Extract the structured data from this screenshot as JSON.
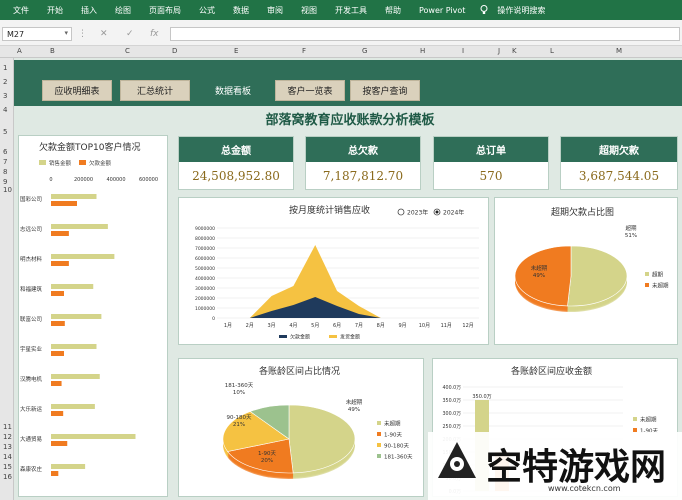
{
  "ribbon": {
    "menu": [
      "文件",
      "开始",
      "插入",
      "绘图",
      "页面布局",
      "公式",
      "数据",
      "审阅",
      "视图",
      "开发工具",
      "帮助",
      "Power Pivot"
    ],
    "search": "操作说明搜索"
  },
  "formula": {
    "name_box": "M27",
    "fx": "fx"
  },
  "columns": [
    "A",
    "B",
    "C",
    "D",
    "E",
    "F",
    "G",
    "H",
    "I",
    "J",
    "K",
    "L",
    "M"
  ],
  "rows": [
    "1",
    "2",
    "3",
    "4",
    "5",
    "6",
    "7",
    "8",
    "9",
    "10",
    "11",
    "12",
    "13",
    "14",
    "15",
    "16"
  ],
  "tabs": [
    "应收明细表",
    "汇总统计",
    "数据看板",
    "客户一览表",
    "按客户查询"
  ],
  "dashboard_title": "部落窝教育应收账款分析模板",
  "kpis": [
    {
      "label": "总金额",
      "value": "24,508,952.80"
    },
    {
      "label": "总欠款",
      "value": "7,187,812.70"
    },
    {
      "label": "总订单",
      "value": "570"
    },
    {
      "label": "超期欠款",
      "value": "3,687,544.05"
    }
  ],
  "colors": {
    "green": "#2f6e58",
    "gold": "#f5c242",
    "navy": "#1f3a5c",
    "olive": "#d4d48a",
    "orange": "#f07b20",
    "tan": "#dad1bc"
  },
  "chart_data": [
    {
      "type": "bar",
      "title": "欠款金额TOP10客户情况",
      "series": [
        {
          "name": "销售金额",
          "values": [
            280000,
            350000,
            390000,
            260000,
            310000,
            280000,
            300000,
            270000,
            520000,
            210000
          ]
        },
        {
          "name": "欠款金额",
          "values": [
            160000,
            110000,
            110000,
            80000,
            85000,
            80000,
            65000,
            75000,
            100000,
            45000
          ]
        }
      ],
      "categories": [
        "国彩公司",
        "志远公司",
        "明杰材料",
        "和福建筑",
        "联富公司",
        "宇星实业",
        "汉腾电机",
        "大乐新运",
        "大通贸易",
        "森康农庄"
      ],
      "xticks": [
        "0",
        "200000",
        "400000",
        "600000",
        "800000"
      ]
    },
    {
      "type": "area",
      "title": "按月度统计销售应收",
      "legend": [
        "2023年",
        "2024年"
      ],
      "legend_selected": "2024年",
      "categories": [
        "1月",
        "2月",
        "3月",
        "4月",
        "5月",
        "6月",
        "7月",
        "8月",
        "9月",
        "10月",
        "11月",
        "12月"
      ],
      "yticks": [
        "0",
        "1000000",
        "2000000",
        "3000000",
        "4000000",
        "5000000",
        "6000000",
        "7000000",
        "8000000",
        "9000000"
      ],
      "ylim": [
        0,
        9000000
      ],
      "series": [
        {
          "name": "欠款金额",
          "values": [
            0,
            0,
            700000,
            1300000,
            2100000,
            1200000,
            400000,
            0,
            0,
            0,
            0,
            0
          ]
        },
        {
          "name": "发货金额",
          "values": [
            0,
            0,
            2200000,
            3200000,
            7300000,
            2700000,
            1200000,
            0,
            0,
            0,
            0,
            0
          ]
        }
      ]
    },
    {
      "type": "pie",
      "title": "超期欠款占比图",
      "labels": [
        "超期",
        "未超期"
      ],
      "values": [
        51,
        49
      ],
      "value_labels": [
        "超期\n51%",
        "未超期\n49%"
      ]
    },
    {
      "type": "pie",
      "title": "各账龄区间占比情况",
      "labels": [
        "未超期",
        "1-90天",
        "90-180天",
        "181-360天"
      ],
      "values": [
        49,
        20,
        21,
        10
      ],
      "value_labels": [
        "未超期\n49%",
        "1-90天\n20%",
        "90-180天\n21%",
        "181-360天\n10%"
      ]
    },
    {
      "type": "bar",
      "title": "各账龄区间应收金额",
      "categories": [
        "未超期",
        "1-90天"
      ],
      "values": [
        3500000,
        1500000
      ],
      "data_labels": [
        "350.0万"
      ],
      "yticks": [
        "0.0万",
        "50.0万",
        "100.0万",
        "150.0万",
        "200.0万",
        "250.0万",
        "300.0万",
        "350.0万",
        "400.0万"
      ],
      "ylim": [
        0,
        4000000
      ],
      "legend": [
        "未超期",
        "1-90天"
      ]
    }
  ],
  "watermark": {
    "text": "空特游戏网",
    "url": "www.cotekcn.com"
  }
}
